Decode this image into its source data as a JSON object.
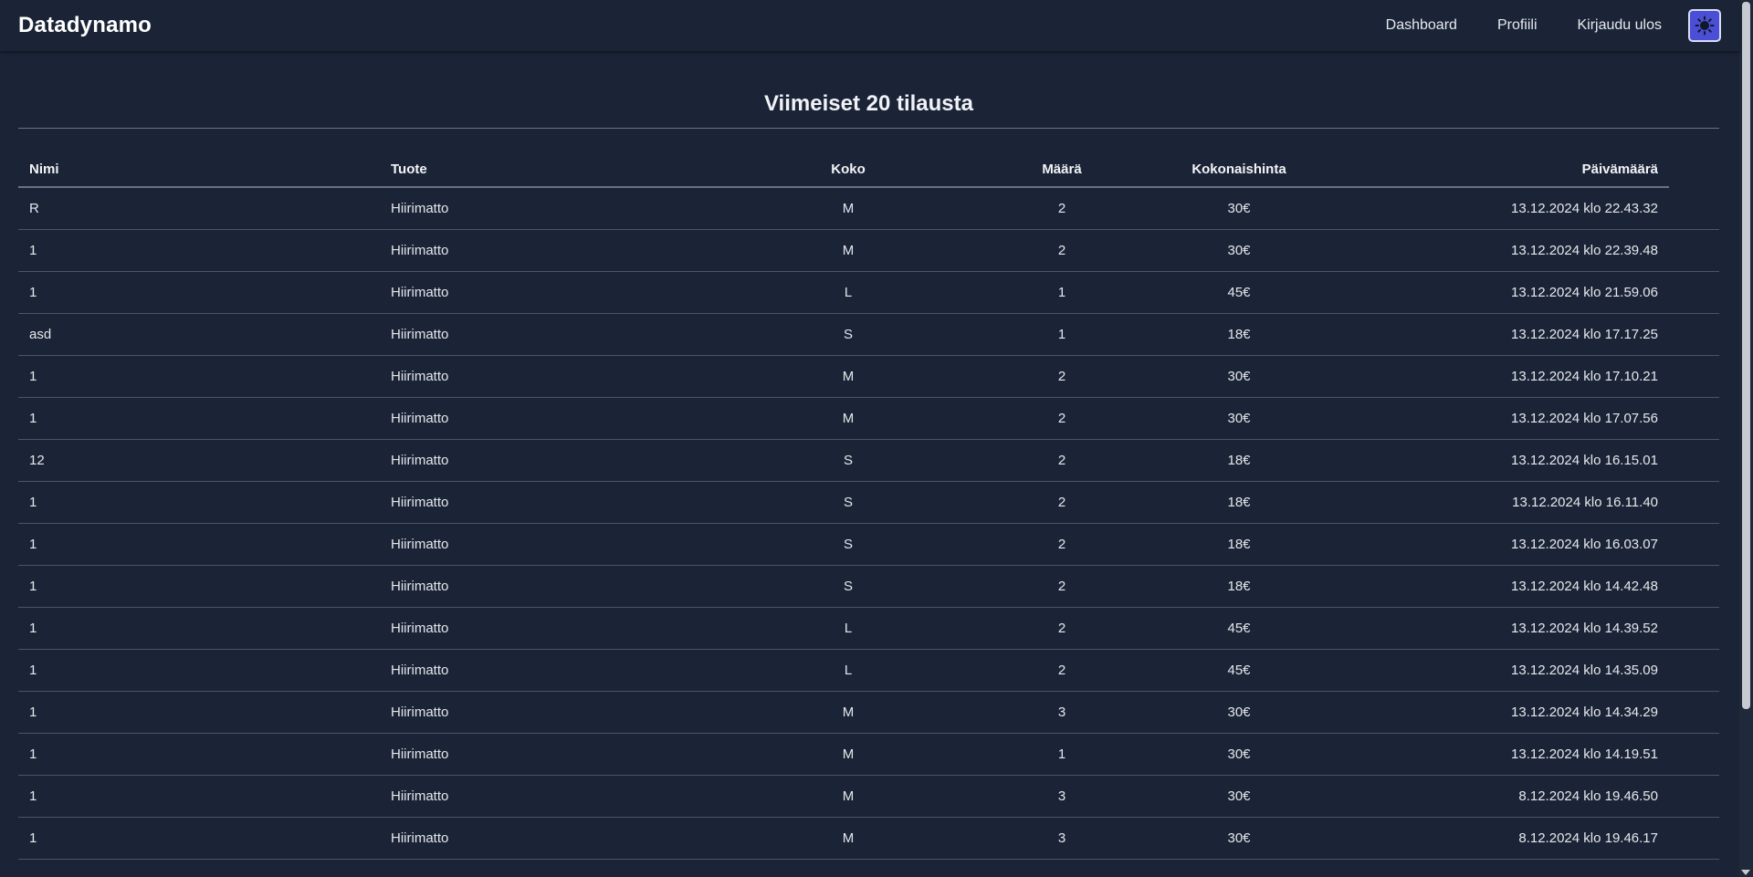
{
  "app": {
    "brand": "Datadynamo"
  },
  "nav": {
    "dashboard": "Dashboard",
    "profile": "Profiili",
    "logout": "Kirjaudu ulos",
    "theme_icon": "sun-icon"
  },
  "page": {
    "title": "Viimeiset 20 tilausta"
  },
  "table": {
    "headers": [
      "Nimi",
      "Tuote",
      "Koko",
      "Määrä",
      "Kokonaishinta",
      "Päivämäärä"
    ],
    "rows": [
      [
        "R",
        "Hiirimatto",
        "M",
        "2",
        "30€",
        "13.12.2024 klo 22.43.32"
      ],
      [
        "1",
        "Hiirimatto",
        "M",
        "2",
        "30€",
        "13.12.2024 klo 22.39.48"
      ],
      [
        "1",
        "Hiirimatto",
        "L",
        "1",
        "45€",
        "13.12.2024 klo 21.59.06"
      ],
      [
        "asd",
        "Hiirimatto",
        "S",
        "1",
        "18€",
        "13.12.2024 klo 17.17.25"
      ],
      [
        "1",
        "Hiirimatto",
        "M",
        "2",
        "30€",
        "13.12.2024 klo 17.10.21"
      ],
      [
        "1",
        "Hiirimatto",
        "M",
        "2",
        "30€",
        "13.12.2024 klo 17.07.56"
      ],
      [
        "12",
        "Hiirimatto",
        "S",
        "2",
        "18€",
        "13.12.2024 klo 16.15.01"
      ],
      [
        "1",
        "Hiirimatto",
        "S",
        "2",
        "18€",
        "13.12.2024 klo 16.11.40"
      ],
      [
        "1",
        "Hiirimatto",
        "S",
        "2",
        "18€",
        "13.12.2024 klo 16.03.07"
      ],
      [
        "1",
        "Hiirimatto",
        "S",
        "2",
        "18€",
        "13.12.2024 klo 14.42.48"
      ],
      [
        "1",
        "Hiirimatto",
        "L",
        "2",
        "45€",
        "13.12.2024 klo 14.39.52"
      ],
      [
        "1",
        "Hiirimatto",
        "L",
        "2",
        "45€",
        "13.12.2024 klo 14.35.09"
      ],
      [
        "1",
        "Hiirimatto",
        "M",
        "3",
        "30€",
        "13.12.2024 klo 14.34.29"
      ],
      [
        "1",
        "Hiirimatto",
        "M",
        "1",
        "30€",
        "13.12.2024 klo 14.19.51"
      ],
      [
        "1",
        "Hiirimatto",
        "M",
        "3",
        "30€",
        "8.12.2024 klo 19.46.50"
      ],
      [
        "1",
        "Hiirimatto",
        "M",
        "3",
        "30€",
        "8.12.2024 klo 19.46.17"
      ]
    ]
  },
  "colors": {
    "background": "#1b2437",
    "accent": "#4b4fd6",
    "divider": "#4b5563"
  }
}
